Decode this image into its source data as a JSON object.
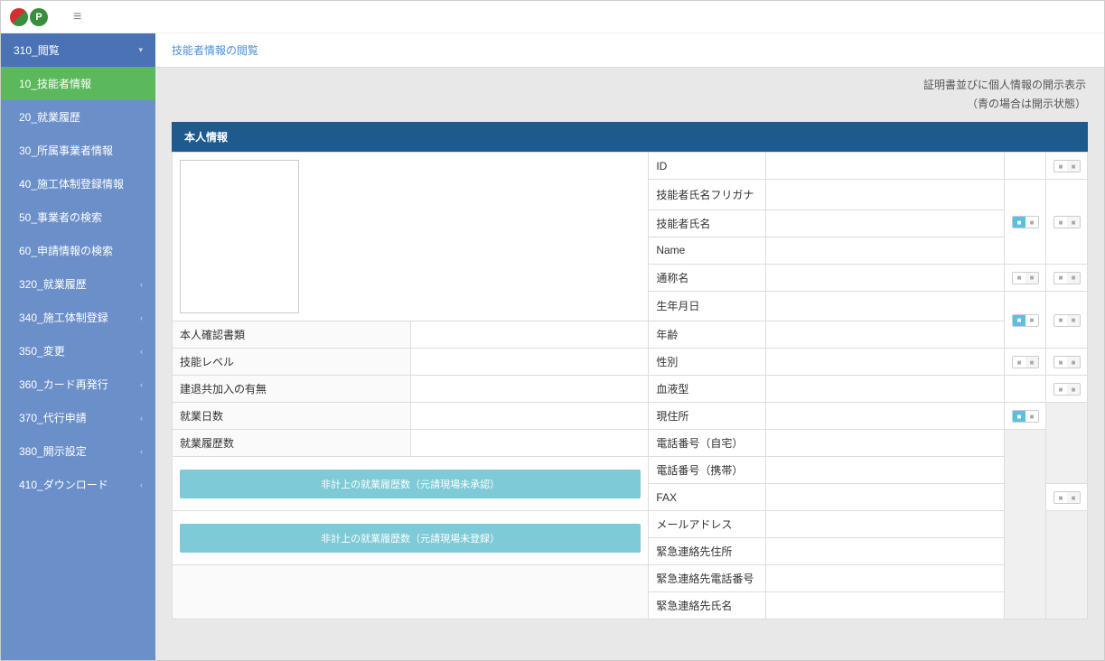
{
  "topbar": {
    "logo_u": "U",
    "logo_p": "P",
    "menu_icon": "≡"
  },
  "sidebar": {
    "groups": [
      {
        "label": "310_閲覧",
        "expanded": true
      },
      {
        "label": "320_就業履歴",
        "expanded": false
      },
      {
        "label": "340_施工体制登録",
        "expanded": false
      },
      {
        "label": "350_変更",
        "expanded": false
      },
      {
        "label": "360_カード再発行",
        "expanded": false
      },
      {
        "label": "370_代行申請",
        "expanded": false
      },
      {
        "label": "380_開示設定",
        "expanded": false
      },
      {
        "label": "410_ダウンロード",
        "expanded": false
      }
    ],
    "sub_310": [
      {
        "label": "10_技能者情報",
        "active": true
      },
      {
        "label": "20_就業履歴",
        "active": false
      },
      {
        "label": "30_所属事業者情報",
        "active": false
      },
      {
        "label": "40_施工体制登録情報",
        "active": false
      },
      {
        "label": "50_事業者の検索",
        "active": false
      },
      {
        "label": "60_申請情報の検索",
        "active": false
      }
    ]
  },
  "breadcrumb": "技能者情報の閲覧",
  "disclosure": {
    "line1": "証明書並びに個人情報の開示表示",
    "line2": "（青の場合は開示状態）"
  },
  "section_title": "本人情報",
  "left_rows": [
    {
      "label": "本人確認書類"
    },
    {
      "label": "技能レベル"
    },
    {
      "label": "建退共加入の有無"
    },
    {
      "label": "就業日数"
    },
    {
      "label": "就業履歴数"
    }
  ],
  "aux_buttons": [
    "非計上の就業履歴数（元請現場未承認）",
    "非計上の就業履歴数（元請現場未登録）"
  ],
  "rows": [
    {
      "label": "ID",
      "t1": null,
      "t2": "off"
    },
    {
      "label": "技能者氏名フリガナ",
      "t1": null,
      "t2": null
    },
    {
      "label": "技能者氏名",
      "t1": "on",
      "t2": "off"
    },
    {
      "label": "Name",
      "t1": null,
      "t2": null
    },
    {
      "label": "通称名",
      "t1": "off",
      "t2": "off"
    },
    {
      "label": "生年月日",
      "t1": "on",
      "t2": "off"
    },
    {
      "label": "年齢",
      "t1": null,
      "t2": null
    },
    {
      "label": "性別",
      "t1": "off",
      "t2": "off"
    },
    {
      "label": "血液型",
      "t1": null,
      "t2": "off"
    },
    {
      "label": "現住所",
      "t1": "on",
      "t2": null
    },
    {
      "label": "電話番号（自宅）",
      "t1": null,
      "t2": null
    },
    {
      "label": "電話番号（携帯）",
      "t1": null,
      "t2": null
    },
    {
      "label": "FAX",
      "t1": null,
      "t2": "off"
    },
    {
      "label": "メールアドレス",
      "t1": null,
      "t2": null
    },
    {
      "label": "緊急連絡先住所",
      "t1": null,
      "t2": null
    },
    {
      "label": "緊急連絡先電話番号",
      "t1": null,
      "t2": null
    },
    {
      "label": "緊急連絡先氏名",
      "t1": null,
      "t2": null
    }
  ]
}
